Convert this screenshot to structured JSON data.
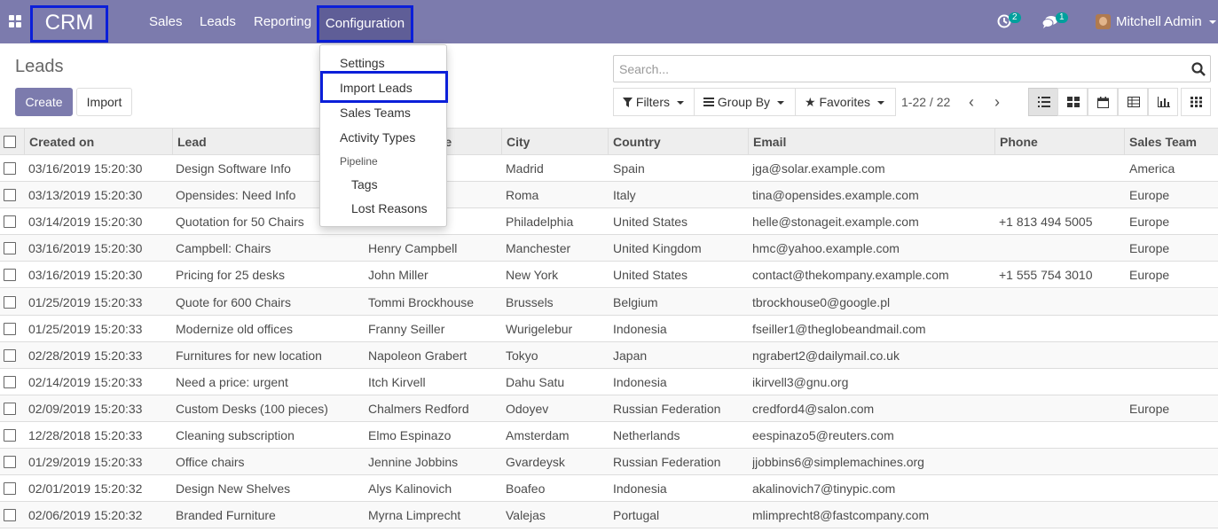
{
  "navbar": {
    "brand": "CRM",
    "menu": [
      "Sales",
      "Leads",
      "Reporting",
      "Configuration"
    ],
    "activity_count": "2",
    "message_count": "1",
    "user_name": "Mitchell Admin"
  },
  "page": {
    "title": "Leads",
    "create_label": "Create",
    "import_label": "Import"
  },
  "search": {
    "placeholder": "Search...",
    "filters_label": "Filters",
    "group_by_label": "Group By",
    "favorites_label": "Favorites",
    "pager": "1-22 / 22"
  },
  "config_menu": {
    "items": [
      "Settings",
      "Import Leads",
      "Sales Teams",
      "Activity Types"
    ],
    "section": "Pipeline",
    "sub_items": [
      "Tags",
      "Lost Reasons"
    ]
  },
  "table": {
    "headers": [
      "Created on",
      "Lead",
      "Contact Name",
      "City",
      "Country",
      "Email",
      "Phone",
      "Sales Team"
    ],
    "rows": [
      [
        "03/16/2019 15:20:30",
        "Design Software Info",
        "",
        "Madrid",
        "Spain",
        "jga@solar.example.com",
        "",
        "America"
      ],
      [
        "03/13/2019 15:20:30",
        "Opensides: Need Info",
        "",
        "Roma",
        "Italy",
        "tina@opensides.example.com",
        "",
        "Europe"
      ],
      [
        "03/14/2019 15:20:30",
        "Quotation for 50 Chairs",
        "",
        "Philadelphia",
        "United States",
        "helle@stonageit.example.com",
        "+1 813 494 5005",
        "Europe"
      ],
      [
        "03/16/2019 15:20:30",
        "Campbell: Chairs",
        "Henry Campbell",
        "Manchester",
        "United Kingdom",
        "hmc@yahoo.example.com",
        "",
        "Europe"
      ],
      [
        "03/16/2019 15:20:30",
        "Pricing for 25 desks",
        "John Miller",
        "New York",
        "United States",
        "contact@thekompany.example.com",
        "+1 555 754 3010",
        "Europe"
      ],
      [
        "01/25/2019 15:20:33",
        "Quote for 600 Chairs",
        "Tommi Brockhouse",
        "Brussels",
        "Belgium",
        "tbrockhouse0@google.pl",
        "",
        ""
      ],
      [
        "01/25/2019 15:20:33",
        "Modernize old offices",
        "Franny Seiller",
        "Wurigelebur",
        "Indonesia",
        "fseiller1@theglobeandmail.com",
        "",
        ""
      ],
      [
        "02/28/2019 15:20:33",
        "Furnitures for new location",
        "Napoleon Grabert",
        "Tokyo",
        "Japan",
        "ngrabert2@dailymail.co.uk",
        "",
        ""
      ],
      [
        "02/14/2019 15:20:33",
        "Need a price: urgent",
        "Itch Kirvell",
        "Dahu Satu",
        "Indonesia",
        "ikirvell3@gnu.org",
        "",
        ""
      ],
      [
        "02/09/2019 15:20:33",
        "Custom Desks (100 pieces)",
        "Chalmers Redford",
        "Odoyev",
        "Russian Federation",
        "credford4@salon.com",
        "",
        "Europe"
      ],
      [
        "12/28/2018 15:20:33",
        "Cleaning subscription",
        "Elmo Espinazo",
        "Amsterdam",
        "Netherlands",
        "eespinazo5@reuters.com",
        "",
        ""
      ],
      [
        "01/29/2019 15:20:33",
        "Office chairs",
        "Jennine Jobbins",
        "Gvardeysk",
        "Russian Federation",
        "jjobbins6@simplemachines.org",
        "",
        ""
      ],
      [
        "02/01/2019 15:20:32",
        "Design New Shelves",
        "Alys Kalinovich",
        "Boafeo",
        "Indonesia",
        "akalinovich7@tinypic.com",
        "",
        ""
      ],
      [
        "02/06/2019 15:20:32",
        "Branded Furniture",
        "Myrna Limprecht",
        "Valejas",
        "Portugal",
        "mlimprecht8@fastcompany.com",
        "",
        ""
      ]
    ]
  }
}
